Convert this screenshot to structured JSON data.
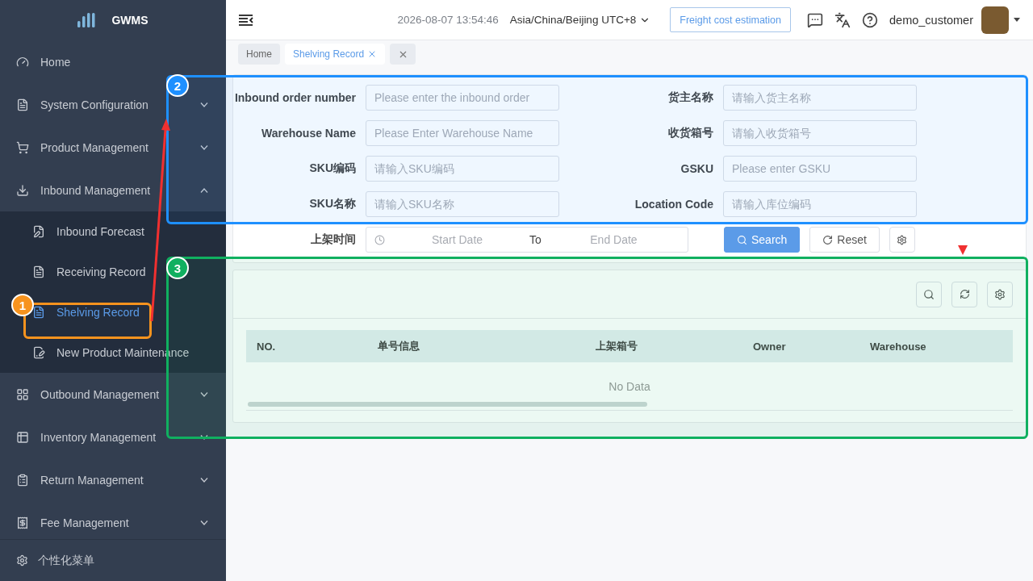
{
  "sidebar": {
    "logo": "GWMS",
    "items": [
      {
        "label": "Home"
      },
      {
        "label": "System Configuration",
        "expanded": false
      },
      {
        "label": "Product Management",
        "expanded": false
      },
      {
        "label": "Inbound Management",
        "expanded": true,
        "children": [
          {
            "label": "Inbound Forecast",
            "selected": false
          },
          {
            "label": "Receiving Record",
            "selected": false
          },
          {
            "label": "Shelving Record",
            "selected": true
          },
          {
            "label": "New Product Maintenance",
            "selected": false
          }
        ]
      },
      {
        "label": "Outbound Management",
        "expanded": false
      },
      {
        "label": "Inventory Management",
        "expanded": false
      },
      {
        "label": "Return Management",
        "expanded": false
      },
      {
        "label": "Fee Management",
        "expanded": false
      }
    ],
    "footer": "个性化菜单"
  },
  "header": {
    "datetime": "2026-08-07 13:54:46",
    "timezone": "Asia/China/Beijing UTC+8",
    "freight_button": "Freight cost estimation",
    "user": "demo_customer"
  },
  "tabs": [
    {
      "label": "Home",
      "selected": false
    },
    {
      "label": "Shelving Record",
      "selected": true
    }
  ],
  "search_form": {
    "fields": [
      {
        "label": "Inbound order number",
        "placeholder": "Please enter the inbound order"
      },
      {
        "label": "货主名称",
        "placeholder": "请输入货主名称"
      },
      {
        "label": "Warehouse Name",
        "placeholder": "Please Enter Warehouse Name"
      },
      {
        "label": "收货箱号",
        "placeholder": "请输入收货箱号"
      },
      {
        "label": "SKU编码",
        "placeholder": "请输入SKU编码"
      },
      {
        "label": "GSKU",
        "placeholder": "Please enter GSKU"
      },
      {
        "label": "SKU名称",
        "placeholder": "请输入SKU名称"
      },
      {
        "label": "Location Code",
        "placeholder": "请输入库位编码"
      }
    ],
    "date_range": {
      "label": "上架时间",
      "start_placeholder": "Start Date",
      "separator": "To",
      "end_placeholder": "End Date"
    },
    "buttons": [
      {
        "label": "Search",
        "kind": "primary"
      },
      {
        "label": "Reset",
        "kind": "default"
      }
    ]
  },
  "table": {
    "columns": [
      "NO.",
      "单号信息",
      "上架箱号",
      "Owner",
      "Warehouse"
    ],
    "empty_text": "No Data"
  },
  "annotations": [
    {
      "label": "1",
      "color": "#f7931e"
    },
    {
      "label": "2",
      "color": "#1e90ff"
    },
    {
      "label": "3",
      "color": "#10b060"
    }
  ]
}
